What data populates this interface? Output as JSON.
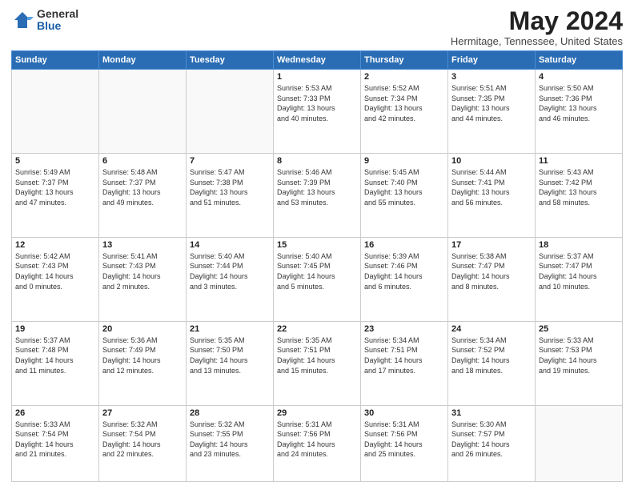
{
  "logo": {
    "general": "General",
    "blue": "Blue"
  },
  "title": "May 2024",
  "location": "Hermitage, Tennessee, United States",
  "days_header": [
    "Sunday",
    "Monday",
    "Tuesday",
    "Wednesday",
    "Thursday",
    "Friday",
    "Saturday"
  ],
  "weeks": [
    [
      {
        "num": "",
        "info": ""
      },
      {
        "num": "",
        "info": ""
      },
      {
        "num": "",
        "info": ""
      },
      {
        "num": "1",
        "info": "Sunrise: 5:53 AM\nSunset: 7:33 PM\nDaylight: 13 hours\nand 40 minutes."
      },
      {
        "num": "2",
        "info": "Sunrise: 5:52 AM\nSunset: 7:34 PM\nDaylight: 13 hours\nand 42 minutes."
      },
      {
        "num": "3",
        "info": "Sunrise: 5:51 AM\nSunset: 7:35 PM\nDaylight: 13 hours\nand 44 minutes."
      },
      {
        "num": "4",
        "info": "Sunrise: 5:50 AM\nSunset: 7:36 PM\nDaylight: 13 hours\nand 46 minutes."
      }
    ],
    [
      {
        "num": "5",
        "info": "Sunrise: 5:49 AM\nSunset: 7:37 PM\nDaylight: 13 hours\nand 47 minutes."
      },
      {
        "num": "6",
        "info": "Sunrise: 5:48 AM\nSunset: 7:37 PM\nDaylight: 13 hours\nand 49 minutes."
      },
      {
        "num": "7",
        "info": "Sunrise: 5:47 AM\nSunset: 7:38 PM\nDaylight: 13 hours\nand 51 minutes."
      },
      {
        "num": "8",
        "info": "Sunrise: 5:46 AM\nSunset: 7:39 PM\nDaylight: 13 hours\nand 53 minutes."
      },
      {
        "num": "9",
        "info": "Sunrise: 5:45 AM\nSunset: 7:40 PM\nDaylight: 13 hours\nand 55 minutes."
      },
      {
        "num": "10",
        "info": "Sunrise: 5:44 AM\nSunset: 7:41 PM\nDaylight: 13 hours\nand 56 minutes."
      },
      {
        "num": "11",
        "info": "Sunrise: 5:43 AM\nSunset: 7:42 PM\nDaylight: 13 hours\nand 58 minutes."
      }
    ],
    [
      {
        "num": "12",
        "info": "Sunrise: 5:42 AM\nSunset: 7:43 PM\nDaylight: 14 hours\nand 0 minutes."
      },
      {
        "num": "13",
        "info": "Sunrise: 5:41 AM\nSunset: 7:43 PM\nDaylight: 14 hours\nand 2 minutes."
      },
      {
        "num": "14",
        "info": "Sunrise: 5:40 AM\nSunset: 7:44 PM\nDaylight: 14 hours\nand 3 minutes."
      },
      {
        "num": "15",
        "info": "Sunrise: 5:40 AM\nSunset: 7:45 PM\nDaylight: 14 hours\nand 5 minutes."
      },
      {
        "num": "16",
        "info": "Sunrise: 5:39 AM\nSunset: 7:46 PM\nDaylight: 14 hours\nand 6 minutes."
      },
      {
        "num": "17",
        "info": "Sunrise: 5:38 AM\nSunset: 7:47 PM\nDaylight: 14 hours\nand 8 minutes."
      },
      {
        "num": "18",
        "info": "Sunrise: 5:37 AM\nSunset: 7:47 PM\nDaylight: 14 hours\nand 10 minutes."
      }
    ],
    [
      {
        "num": "19",
        "info": "Sunrise: 5:37 AM\nSunset: 7:48 PM\nDaylight: 14 hours\nand 11 minutes."
      },
      {
        "num": "20",
        "info": "Sunrise: 5:36 AM\nSunset: 7:49 PM\nDaylight: 14 hours\nand 12 minutes."
      },
      {
        "num": "21",
        "info": "Sunrise: 5:35 AM\nSunset: 7:50 PM\nDaylight: 14 hours\nand 13 minutes."
      },
      {
        "num": "22",
        "info": "Sunrise: 5:35 AM\nSunset: 7:51 PM\nDaylight: 14 hours\nand 15 minutes."
      },
      {
        "num": "23",
        "info": "Sunrise: 5:34 AM\nSunset: 7:51 PM\nDaylight: 14 hours\nand 17 minutes."
      },
      {
        "num": "24",
        "info": "Sunrise: 5:34 AM\nSunset: 7:52 PM\nDaylight: 14 hours\nand 18 minutes."
      },
      {
        "num": "25",
        "info": "Sunrise: 5:33 AM\nSunset: 7:53 PM\nDaylight: 14 hours\nand 19 minutes."
      }
    ],
    [
      {
        "num": "26",
        "info": "Sunrise: 5:33 AM\nSunset: 7:54 PM\nDaylight: 14 hours\nand 21 minutes."
      },
      {
        "num": "27",
        "info": "Sunrise: 5:32 AM\nSunset: 7:54 PM\nDaylight: 14 hours\nand 22 minutes."
      },
      {
        "num": "28",
        "info": "Sunrise: 5:32 AM\nSunset: 7:55 PM\nDaylight: 14 hours\nand 23 minutes."
      },
      {
        "num": "29",
        "info": "Sunrise: 5:31 AM\nSunset: 7:56 PM\nDaylight: 14 hours\nand 24 minutes."
      },
      {
        "num": "30",
        "info": "Sunrise: 5:31 AM\nSunset: 7:56 PM\nDaylight: 14 hours\nand 25 minutes."
      },
      {
        "num": "31",
        "info": "Sunrise: 5:30 AM\nSunset: 7:57 PM\nDaylight: 14 hours\nand 26 minutes."
      },
      {
        "num": "",
        "info": ""
      }
    ]
  ]
}
